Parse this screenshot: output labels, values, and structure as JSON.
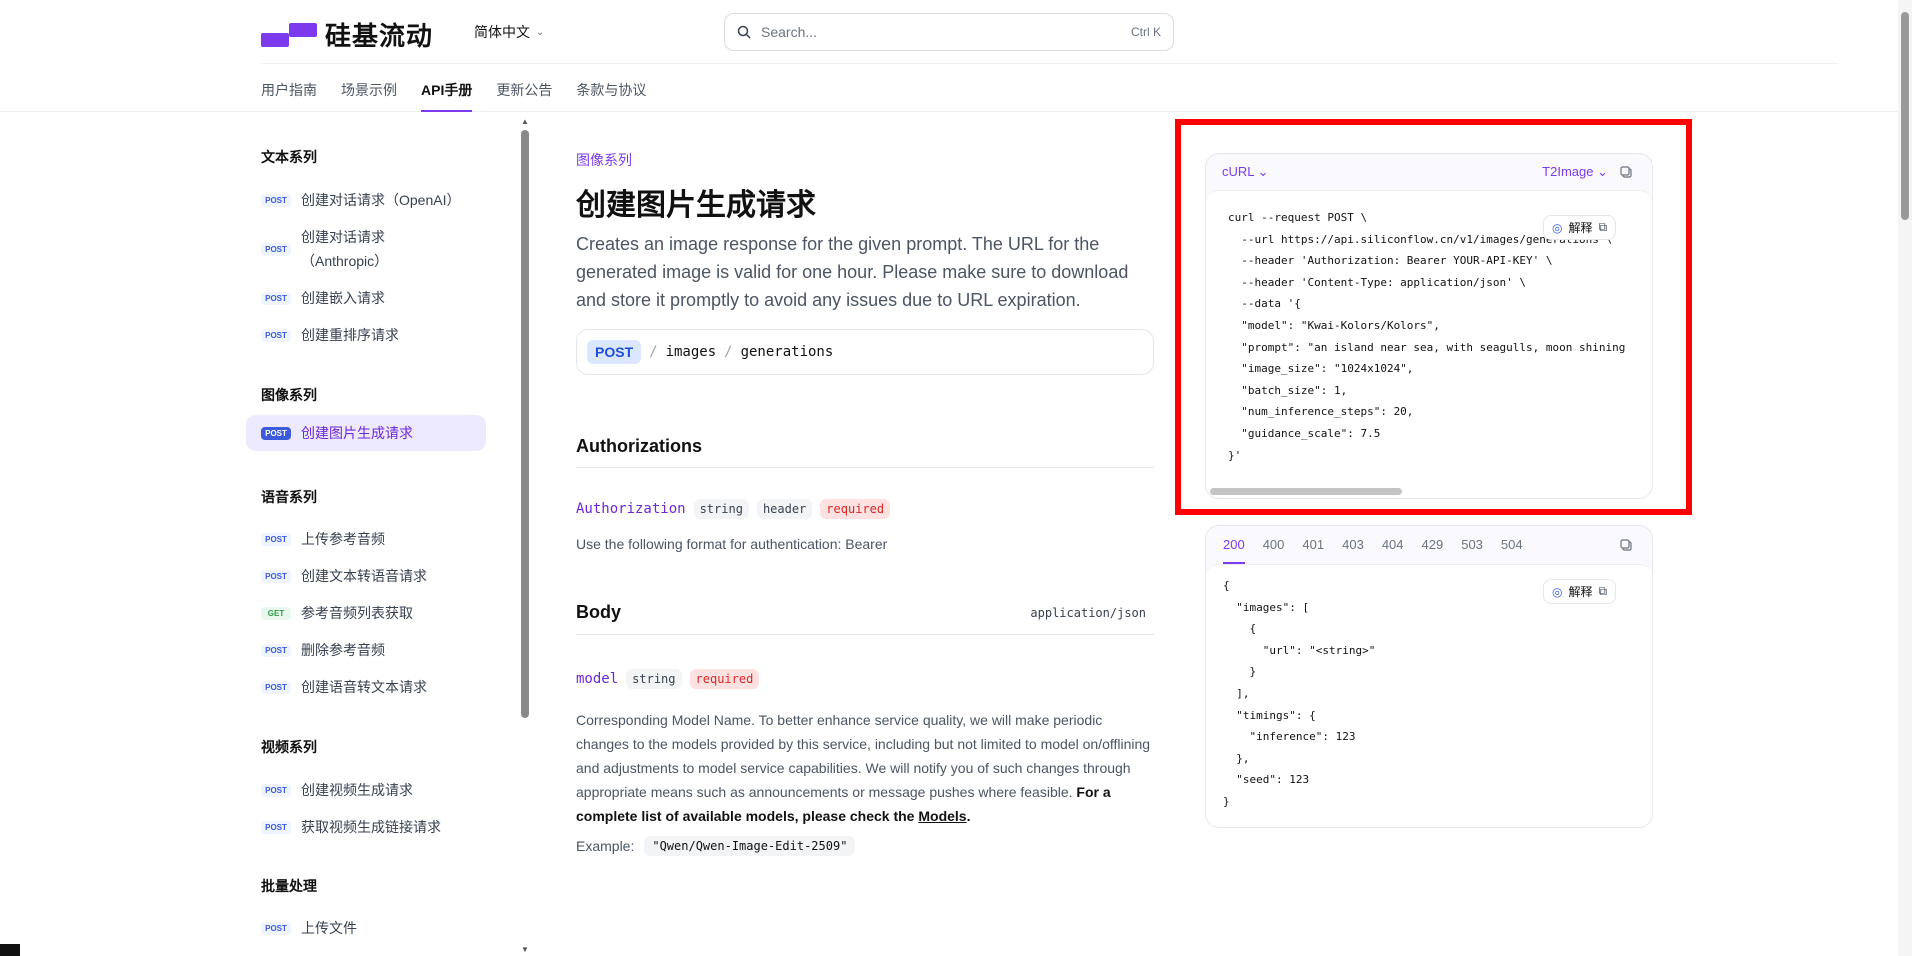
{
  "header": {
    "logo_text": "硅基流动",
    "language": "简体中文",
    "search_placeholder": "Search...",
    "search_shortcut": "Ctrl K",
    "tabs": [
      "用户指南",
      "场景示例",
      "API手册",
      "更新公告",
      "条款与协议"
    ],
    "active_tab": "API手册"
  },
  "sidebar": {
    "groups": [
      {
        "title": "文本系列",
        "items": [
          {
            "method": "POST",
            "label": "创建对话请求（OpenAI）"
          },
          {
            "method": "POST",
            "label": "创建对话请求",
            "label2": "（Anthropic）"
          },
          {
            "method": "POST",
            "label": "创建嵌入请求"
          },
          {
            "method": "POST",
            "label": "创建重排序请求"
          }
        ]
      },
      {
        "title": "图像系列",
        "items": [
          {
            "method": "POST",
            "label": "创建图片生成请求",
            "active": true
          }
        ]
      },
      {
        "title": "语音系列",
        "items": [
          {
            "method": "POST",
            "label": "上传参考音频"
          },
          {
            "method": "POST",
            "label": "创建文本转语音请求"
          },
          {
            "method": "GET",
            "label": "参考音频列表获取"
          },
          {
            "method": "POST",
            "label": "删除参考音频"
          },
          {
            "method": "POST",
            "label": "创建语音转文本请求"
          }
        ]
      },
      {
        "title": "视频系列",
        "items": [
          {
            "method": "POST",
            "label": "创建视频生成请求"
          },
          {
            "method": "POST",
            "label": "获取视频生成链接请求"
          }
        ]
      },
      {
        "title": "批量处理",
        "items": [
          {
            "method": "POST",
            "label": "上传文件"
          }
        ]
      }
    ]
  },
  "main": {
    "breadcrumb": "图像系列",
    "title": "创建图片生成请求",
    "description": "Creates an image response for the given prompt. The URL for the generated image is valid for one hour. Please make sure to download and store it promptly to avoid any issues due to URL expiration.",
    "endpoint": {
      "method": "POST",
      "path": [
        "images",
        "generations"
      ]
    },
    "auth": {
      "heading": "Authorizations",
      "param": "Authorization",
      "tags": [
        "string",
        "header"
      ],
      "required": "required",
      "text": "Use the following format for authentication: Bearer"
    },
    "body": {
      "heading": "Body",
      "content_type": "application/json",
      "param": "model",
      "tag": "string",
      "required": "required",
      "text": "Corresponding Model Name. To better enhance service quality, we will make periodic changes to the models provided by this service, including but not limited to model on/offlining and adjustments to model service capabilities. We will notify you of such changes through appropriate means such as announcements or message pushes where feasible.",
      "text_bold": "For a complete list of available models, please check the",
      "link": "Models",
      "example_label": "Example:",
      "example_value": "\"Qwen/Qwen-Image-Edit-2509\""
    }
  },
  "request_panel": {
    "lang": "cURL",
    "example": "T2Image",
    "explain": "解释",
    "code_lines": [
      "curl --request POST \\",
      "  --url https://api.siliconflow.cn/v1/images/generations \\",
      "  --header 'Authorization: Bearer YOUR-API-KEY' \\",
      "  --header 'Content-Type: application/json' \\",
      "  --data '{",
      "  \"model\": \"Kwai-Kolors/Kolors\",",
      "  \"prompt\": \"an island near sea, with seagulls, moon shining",
      "  \"image_size\": \"1024x1024\",",
      "  \"batch_size\": 1,",
      "  \"num_inference_steps\": 20,",
      "  \"guidance_scale\": 7.5",
      "}'"
    ]
  },
  "response_panel": {
    "status_codes": [
      "200",
      "400",
      "401",
      "403",
      "404",
      "429",
      "503",
      "504"
    ],
    "active_status": "200",
    "explain": "解释",
    "code_lines": [
      "{",
      "  \"images\": [",
      "    {",
      "      \"url\": \"<string>\"",
      "    }",
      "  ],",
      "  \"timings\": {",
      "    \"inference\": 123",
      "  },",
      "  \"seed\": 123",
      "}"
    ]
  },
  "colors": {
    "accent": "#7c3aed",
    "highlight_box": "#ff0000"
  }
}
